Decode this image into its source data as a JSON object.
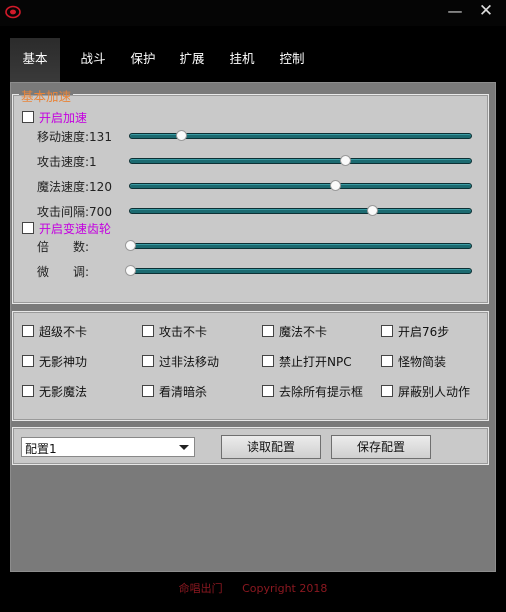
{
  "window": {
    "minimize_label": "—",
    "close_label": "✕"
  },
  "tabs": [
    {
      "label": "基本",
      "active": true
    },
    {
      "label": "战斗"
    },
    {
      "label": "保护"
    },
    {
      "label": "扩展"
    },
    {
      "label": "挂机"
    },
    {
      "label": "控制"
    }
  ],
  "speed_panel": {
    "title": "基本加速",
    "enable_speed": "开启加速",
    "enable_gear": "开启变速齿轮",
    "sliders": [
      {
        "label": "移动速度:131",
        "value_fraction": 0.15
      },
      {
        "label": "攻击速度:1",
        "value_fraction": 0.63
      },
      {
        "label": "魔法速度:120",
        "value_fraction": 0.6
      },
      {
        "label": "攻击间隔:700",
        "value_fraction": 0.71
      },
      {
        "label": "倍　　数:",
        "value_fraction": 0.0
      },
      {
        "label": "微　　调:",
        "value_fraction": 0.0
      }
    ]
  },
  "options": [
    [
      "超级不卡",
      "攻击不卡",
      "魔法不卡",
      "开启76步"
    ],
    [
      "无影神功",
      "过非法移动",
      "禁止打开NPC",
      "怪物简装"
    ],
    [
      "无影魔法",
      "看清暗杀",
      "去除所有提示框",
      "屏蔽别人动作"
    ]
  ],
  "config": {
    "selected": "配置1",
    "load_label": "读取配置",
    "save_label": "保存配置"
  },
  "footer": {
    "brand": "命唱出门",
    "copyright": "Copyright 2018"
  },
  "colors": {
    "accent_legend": "#e8853a",
    "magenta_label": "#c400e0",
    "slider_track": "#1c6a70"
  }
}
